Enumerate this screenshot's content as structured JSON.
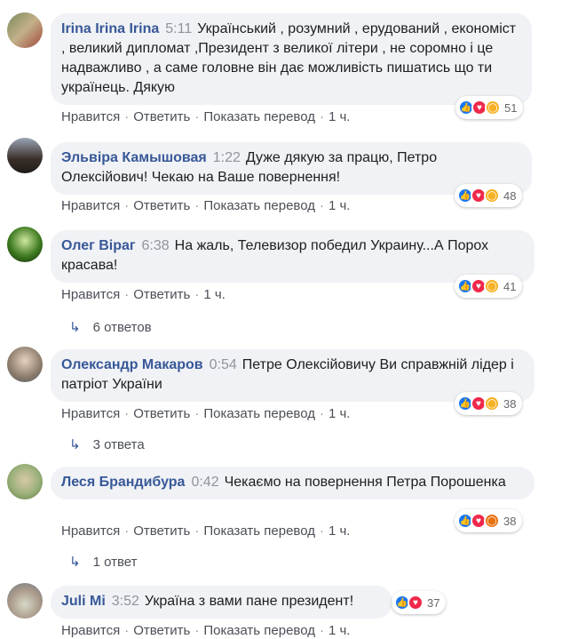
{
  "comments": [
    {
      "author": "Irina Irina Irina",
      "time": "5:11",
      "text": "Український , розумний , ерудований , економіст , великий дипломат ,Президент з великої літери , не соромно і це надважливо , а саме головне він дає можливість пишатись що ти українець. Дякую",
      "like_label": "Нравится",
      "reply_label": "Ответить",
      "translate_label": "Показать перевод",
      "age": "1 ч.",
      "reactions": [
        "like",
        "love",
        "sad"
      ],
      "reaction_count": "51"
    },
    {
      "author": "Эльвіра Камышовая",
      "time": "1:22",
      "text": "Дуже дякую за працю, Петро Олексійович! Чекаю на Ваше повернення!",
      "like_label": "Нравится",
      "reply_label": "Ответить",
      "translate_label": "Показать перевод",
      "age": "1 ч.",
      "reactions": [
        "like",
        "love",
        "sad"
      ],
      "reaction_count": "48"
    },
    {
      "author": "Олег Віраг",
      "time": "6:38",
      "text": "На жаль, Телевизор победил Украину...А Порох красава!",
      "like_label": "Нравится",
      "reply_label": "Ответить",
      "age": "1 ч.",
      "reactions": [
        "like",
        "love",
        "sad"
      ],
      "reaction_count": "41",
      "replies": "6 ответов"
    },
    {
      "author": "Олександр Макаров",
      "time": "0:54",
      "text": "Петре Олексійовичу Ви справжній лідер і патріот України",
      "like_label": "Нравится",
      "reply_label": "Ответить",
      "translate_label": "Показать перевод",
      "age": "1 ч.",
      "reactions": [
        "like",
        "love",
        "haha"
      ],
      "reaction_count": "38",
      "replies": "3 ответа"
    },
    {
      "author": "Леся Брандибура",
      "time": "0:42",
      "text": "Чекаємо на повернення Петра Порошенка",
      "like_label": "Нравится",
      "reply_label": "Ответить",
      "translate_label": "Показать перевод",
      "age": "1 ч.",
      "reactions": [
        "like",
        "love",
        "angry"
      ],
      "reaction_count": "38",
      "replies": "1 ответ"
    },
    {
      "author": "Juli Mi",
      "time": "3:52",
      "text": "Україна з вами пане президент!",
      "like_label": "Нравится",
      "reply_label": "Ответить",
      "translate_label": "Показать перевод",
      "age": "1 ч.",
      "reactions": [
        "like",
        "love"
      ],
      "reaction_count": "37"
    }
  ],
  "colors": {
    "author": "#385898",
    "bubble": "#f0f2f5",
    "like": "#1877f2",
    "love": "#f0284a",
    "sad": "#f7b125"
  }
}
